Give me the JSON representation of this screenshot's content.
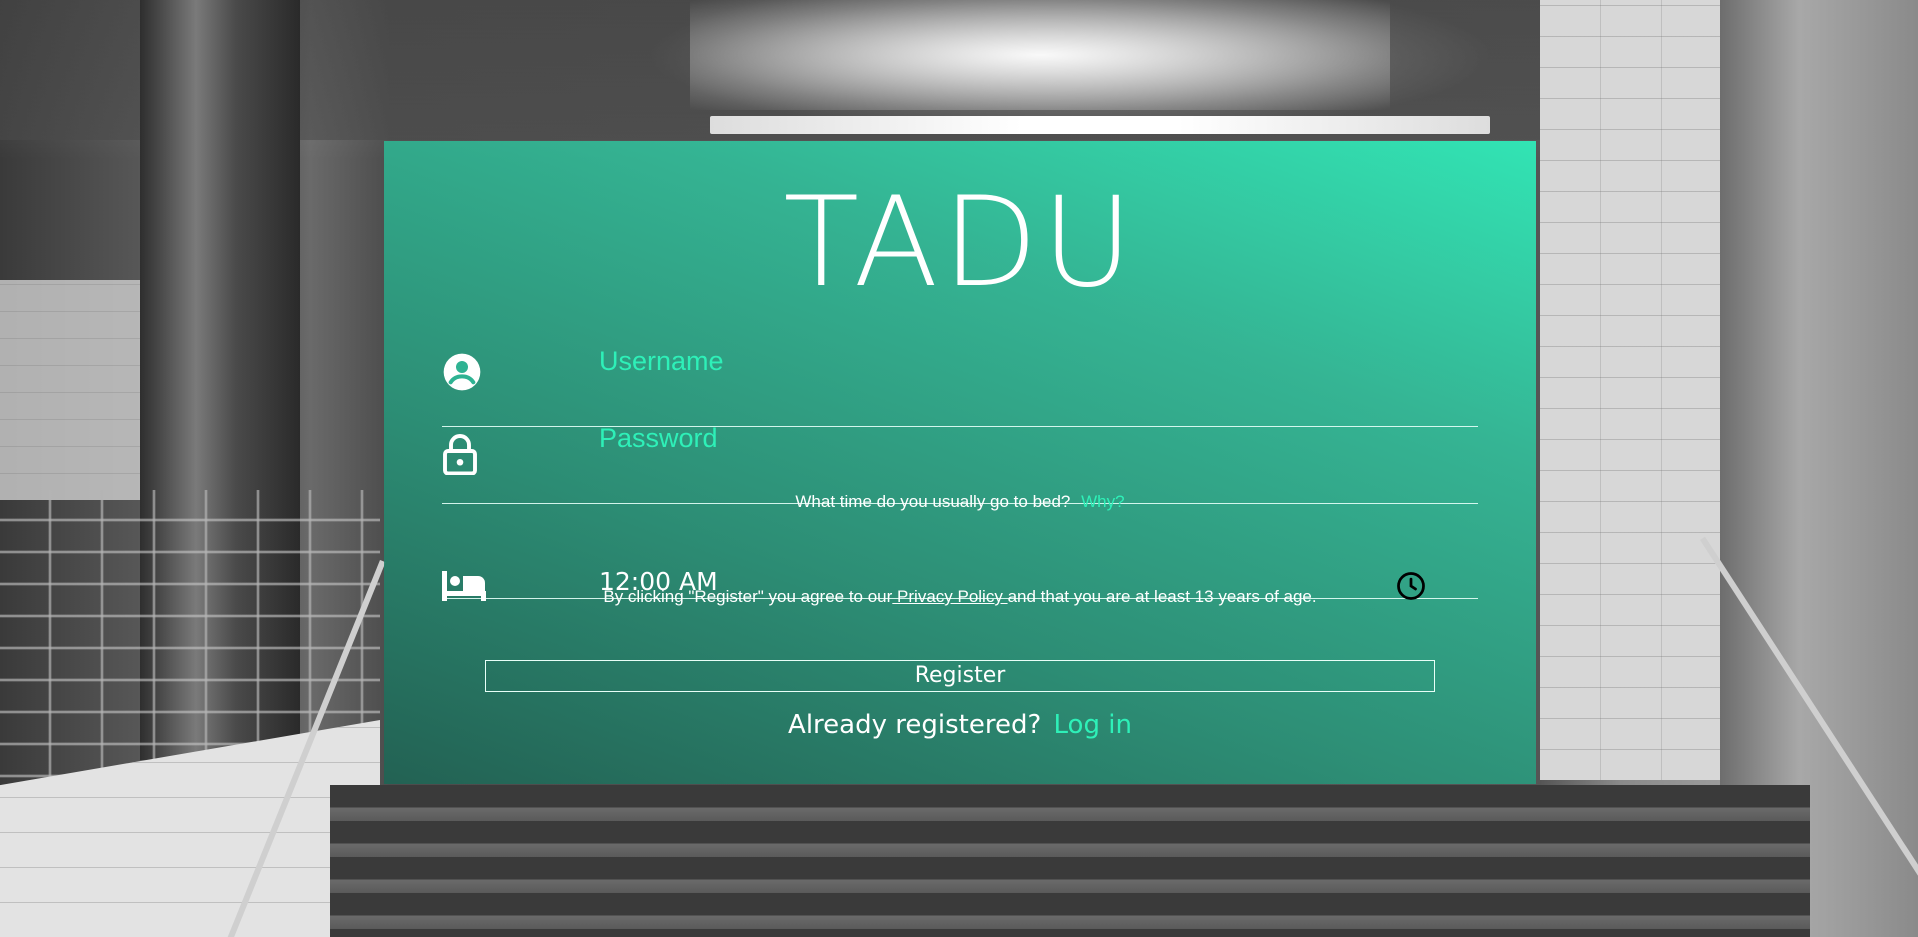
{
  "app": {
    "logo_text": "TADU",
    "accent_color": "#2ef0b8"
  },
  "form": {
    "username": {
      "placeholder": "Username",
      "icon": "account-circle-icon"
    },
    "password": {
      "placeholder": "Password",
      "icon": "lock-icon"
    },
    "bedtime": {
      "question": "What time do you usually go to bed?",
      "why_link": "Why?",
      "value": "12:00 AM",
      "icon": "bed-icon",
      "picker_icon": "clock-icon"
    },
    "terms": {
      "prefix": "By clicking \"Register\" you agree to our",
      "privacy_link": " Privacy Policy ",
      "suffix": "and that you are at least 13 years of age."
    },
    "register_label": "Register",
    "login": {
      "prompt": "Already registered?",
      "link": "Log in"
    }
  }
}
